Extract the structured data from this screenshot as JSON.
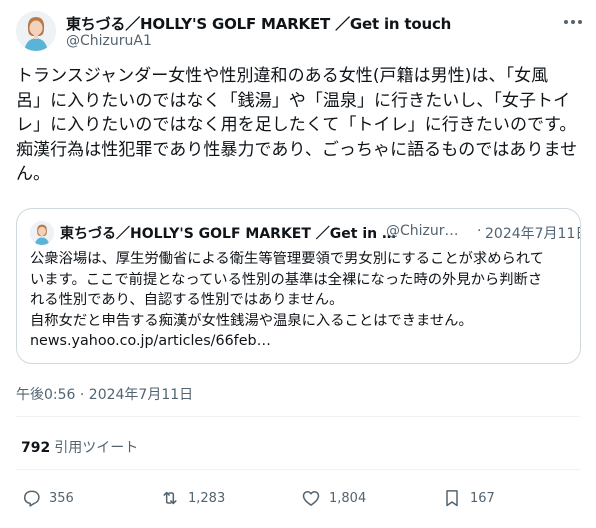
{
  "author": {
    "name": "東ちづる／HOLLY'S GOLF MARKET ／Get in touch",
    "handle": "@ChizuruA1"
  },
  "tweet": {
    "text": "トランスジャンダー女性や性別違和のある女性(戸籍は男性)は、「女風\n呂」に入りたいのではなく「銭湯」や「温泉」に行きたいし、「女子トイ\nレ」に入りたいのではなく用を足したくて「トイレ」に行きたいのです。\n痴漢行為は性犯罪であり性暴力であり、ごっちゃに語るものではありませ\nん。"
  },
  "quote": {
    "name": "東ちづる／HOLLY'S GOLF MARKET ／Get in …",
    "handle": "@Chizur…",
    "separator": "·",
    "date": "2024年7月11日",
    "text": "公衆浴場は、厚生労働省による衛生等管理要領で男女別にすることが求められて\nいます。ここで前提となっている性別の基準は全裸になった時の外見から判断さ\nれる性別であり、自認する性別ではありません。\n自称女だと申告する痴漢が女性銭湯や温泉に入ることはできません。\nnews.yahoo.co.jp/articles/66feb…"
  },
  "timestamp": "午後0:56 · 2024年7月11日",
  "quote_tweets": {
    "count": "792",
    "label": "引用ツイート"
  },
  "actions": {
    "replies": "356",
    "retweets": "1,283",
    "likes": "1,804",
    "bookmarks": "167"
  },
  "icons": {
    "more": "more-horizontal-icon",
    "reply": "reply-bubble-icon",
    "retweet": "retweet-icon",
    "like": "heart-icon",
    "bookmark": "bookmark-icon"
  },
  "colors": {
    "text": "#0f1419",
    "secondary": "#536471",
    "border": "#cfd9de",
    "divider": "#eff3f4",
    "avatar_shirt": "#5ab4d8"
  }
}
